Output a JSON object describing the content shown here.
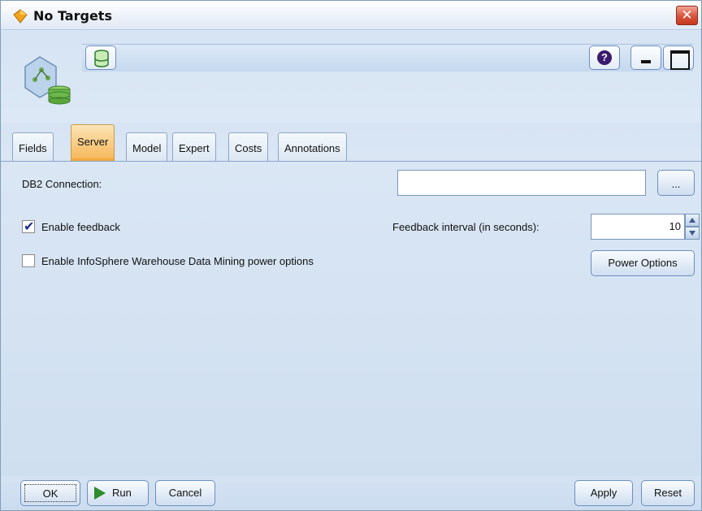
{
  "window": {
    "title": "No Targets",
    "colors": {
      "accent_tab": "#f5b455",
      "close": "#d8533c",
      "background": "#dbe7f5"
    }
  },
  "header": {
    "node_icon": "database-node-icon",
    "db_button_icon": "database-icon",
    "help_label": "?"
  },
  "tabs": [
    {
      "label": "Fields",
      "active": false
    },
    {
      "label": "Server",
      "active": true
    },
    {
      "label": "Model",
      "active": false
    },
    {
      "label": "Expert",
      "active": false
    },
    {
      "label": "Costs",
      "active": false
    },
    {
      "label": "Annotations",
      "active": false
    }
  ],
  "server": {
    "db2_connection_label": "DB2 Connection:",
    "db2_connection_value": "",
    "browse_label": "...",
    "enable_feedback_label": "Enable feedback",
    "enable_feedback_checked": true,
    "feedback_interval_label": "Feedback interval (in seconds):",
    "feedback_interval_value": "10",
    "power_options_checkbox_label": "Enable InfoSphere Warehouse Data Mining power options",
    "power_options_checked": false,
    "power_options_button": "Power Options"
  },
  "footer": {
    "ok": "OK",
    "run": "Run",
    "cancel": "Cancel",
    "apply": "Apply",
    "reset": "Reset"
  }
}
